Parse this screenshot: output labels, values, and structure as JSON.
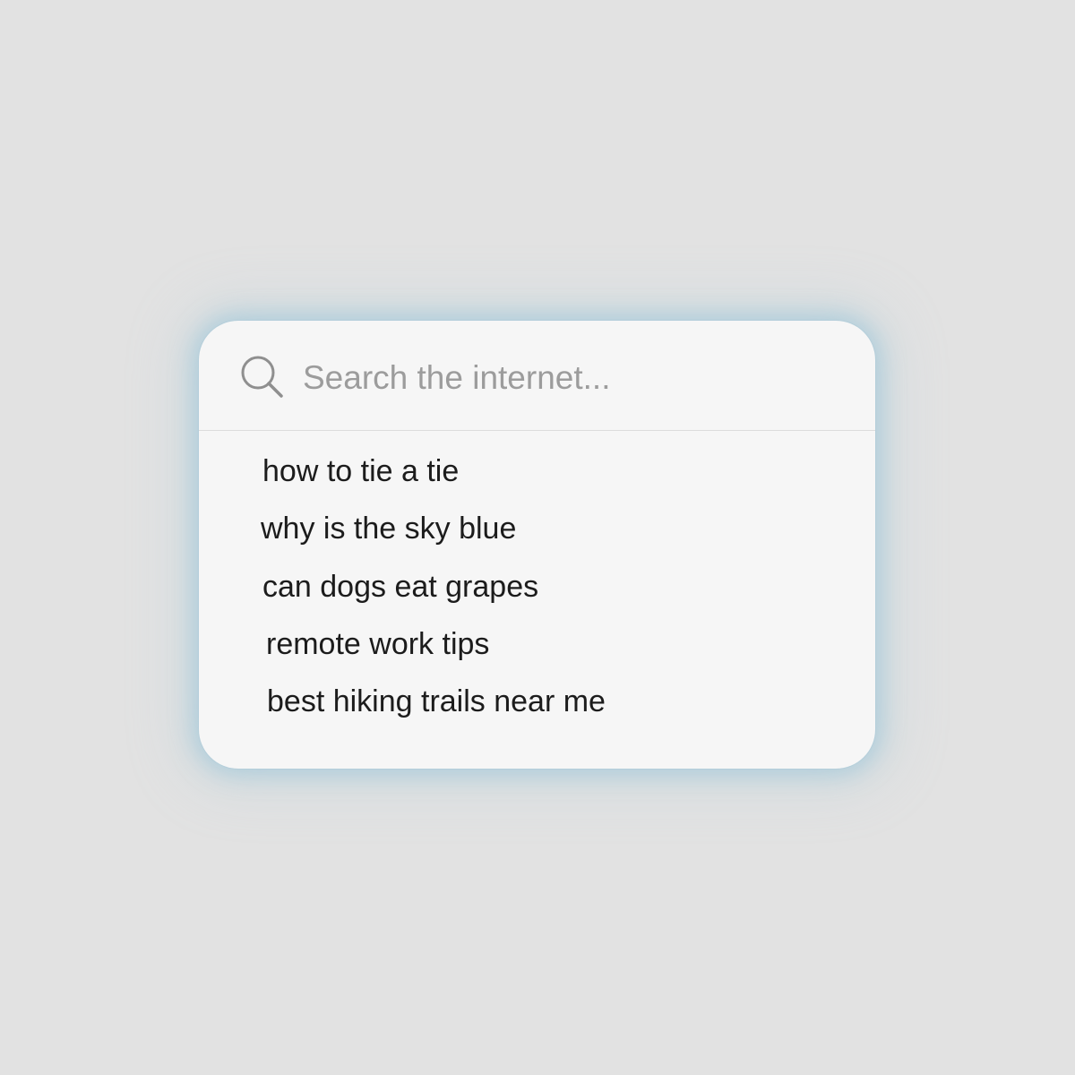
{
  "search": {
    "icon": "search-icon",
    "placeholder": "Search the internet...",
    "value": ""
  },
  "suggestions": [
    "how to tie a tie",
    "why is the sky blue",
    "can dogs eat grapes",
    "remote work tips",
    "best hiking trails near me"
  ],
  "colors": {
    "page_background": "#e2e2e2",
    "card_background": "#f6f6f6",
    "glow": "#96c3d7",
    "placeholder_text": "#9c9c9c",
    "suggestion_text": "#1c1c1c"
  }
}
